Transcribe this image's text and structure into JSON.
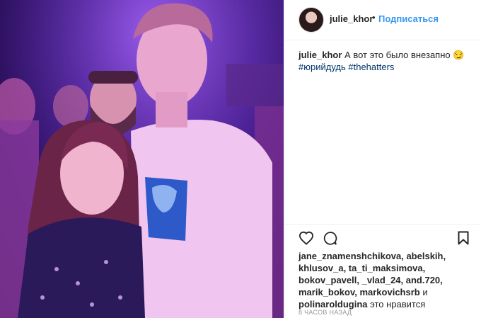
{
  "header": {
    "username": "julie_khor",
    "separator": "•",
    "follow_label": "Подписаться"
  },
  "caption": {
    "username": "julie_khor",
    "text": "А вот это было внезапно 😏",
    "hashtags": [
      "#юрийдудь",
      "#thehatters"
    ]
  },
  "actions": {
    "icons": [
      "heart-icon",
      "comment-icon",
      "bookmark-icon"
    ]
  },
  "likes": {
    "users_line1": "jane_znamenshchikova, abelskih,",
    "users_line2": "khlusov_a, ta_ti_maksimova,",
    "users_line3": "bokov_pavell, _vlad_24, and.720,",
    "users_line4": "marik_bokov, markovichsrb",
    "and_word": "и",
    "users_line5": "polinaroldugina",
    "suffix": "это нравится"
  },
  "timestamp": "8 ЧАСОВ НАЗАД",
  "colors": {
    "link_blue": "#3897f0",
    "hashtag_blue": "#003569",
    "photo_purple": "#6a2fc0"
  }
}
